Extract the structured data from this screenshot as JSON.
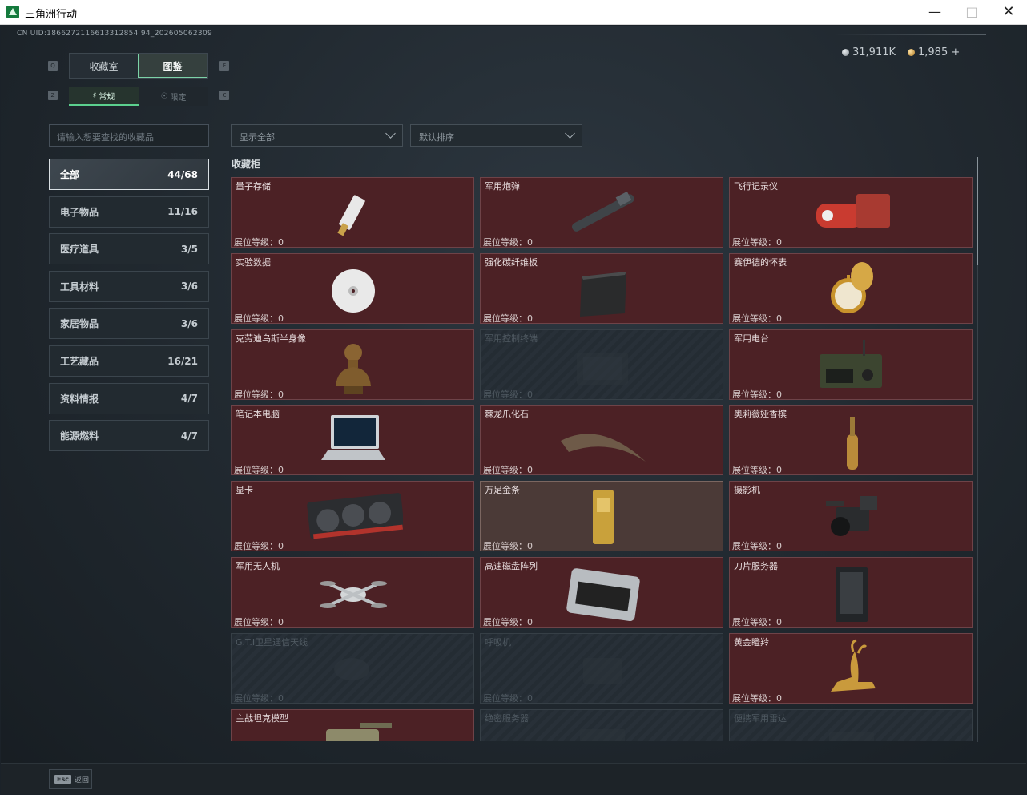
{
  "window": {
    "title": "三角洲行动",
    "min_icon": "minimize-icon",
    "max_icon": "maximize-icon",
    "close_icon": "close-icon"
  },
  "uid": "CN UID:1866272116613312854 94_202605062309",
  "currency": {
    "silver": "31,911K",
    "gold": "1,985 +"
  },
  "tabs_main": [
    "收藏室",
    "图鉴"
  ],
  "tabs_main_active": 1,
  "tabs_sub": [
    "常规",
    "限定"
  ],
  "tabs_sub_active": 0,
  "search": {
    "placeholder": "请输入想要查找的收藏品"
  },
  "filters": {
    "show": "显示全部",
    "sort": "默认排序"
  },
  "categories": [
    {
      "label": "全部",
      "count": "44/68"
    },
    {
      "label": "电子物品",
      "count": "11/16"
    },
    {
      "label": "医疗道具",
      "count": "3/5"
    },
    {
      "label": "工具材料",
      "count": "3/6"
    },
    {
      "label": "家居物品",
      "count": "3/6"
    },
    {
      "label": "工艺藏品",
      "count": "16/21"
    },
    {
      "label": "资料情报",
      "count": "4/7"
    },
    {
      "label": "能源燃料",
      "count": "4/7"
    }
  ],
  "section_title": "收藏柜",
  "level_label": "展位等级：0",
  "items": [
    {
      "name": "量子存储",
      "state": "owned",
      "icon": "usb-drive-icon"
    },
    {
      "name": "军用炮弹",
      "state": "owned",
      "icon": "artillery-shell-icon"
    },
    {
      "name": "飞行记录仪",
      "state": "owned",
      "icon": "flight-recorder-icon"
    },
    {
      "name": "实验数据",
      "state": "owned",
      "icon": "disc-icon"
    },
    {
      "name": "强化碳纤维板",
      "state": "owned",
      "icon": "carbon-plate-icon"
    },
    {
      "name": "赛伊德的怀表",
      "state": "owned",
      "icon": "pocket-watch-icon"
    },
    {
      "name": "克劳迪乌斯半身像",
      "state": "owned",
      "icon": "bust-icon"
    },
    {
      "name": "军用控制终端",
      "state": "locked",
      "icon": "terminal-icon"
    },
    {
      "name": "军用电台",
      "state": "owned",
      "icon": "radio-icon"
    },
    {
      "name": "笔记本电脑",
      "state": "owned",
      "icon": "laptop-icon"
    },
    {
      "name": "棘龙爪化石",
      "state": "owned",
      "icon": "claw-fossil-icon"
    },
    {
      "name": "奥莉薇娅香槟",
      "state": "owned",
      "icon": "champagne-icon"
    },
    {
      "name": "显卡",
      "state": "owned",
      "icon": "graphics-card-icon"
    },
    {
      "name": "万足金条",
      "state": "gold",
      "icon": "gold-bar-icon"
    },
    {
      "name": "摄影机",
      "state": "owned",
      "icon": "camera-icon"
    },
    {
      "name": "军用无人机",
      "state": "owned",
      "icon": "drone-icon"
    },
    {
      "name": "高速磁盘阵列",
      "state": "owned",
      "icon": "disk-array-icon"
    },
    {
      "name": "刀片服务器",
      "state": "owned",
      "icon": "blade-server-icon"
    },
    {
      "name": "G.T.I卫星通信天线",
      "state": "locked",
      "icon": "satellite-dish-icon"
    },
    {
      "name": "呼吸机",
      "state": "locked",
      "icon": "ventilator-icon"
    },
    {
      "name": "黄金瞪羚",
      "state": "owned",
      "icon": "golden-gazelle-icon"
    },
    {
      "name": "主战坦克模型",
      "state": "owned",
      "icon": "tank-model-icon"
    },
    {
      "name": "绝密服务器",
      "state": "locked",
      "icon": "server-icon"
    },
    {
      "name": "便携军用雷达",
      "state": "locked",
      "icon": "radar-icon"
    }
  ],
  "bottom": {
    "esc_key": "Esc",
    "esc_label": "返回"
  },
  "colors": {
    "accent": "#5bd08e",
    "card_owned": "#4c2125",
    "card_locked": "#262e35",
    "card_gold": "#4b3a37"
  }
}
